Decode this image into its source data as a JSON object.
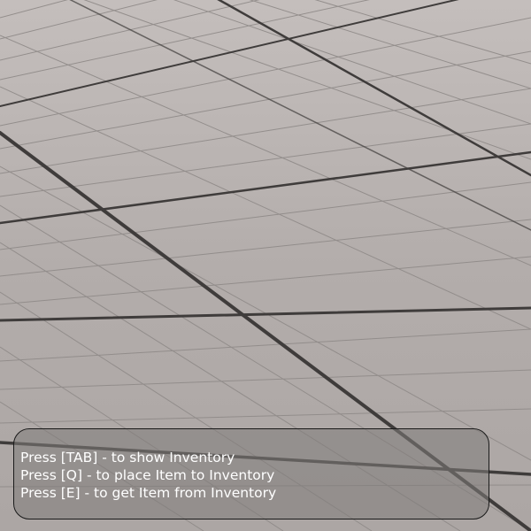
{
  "scene": {
    "floor_base_color": "#b3adab",
    "major_grid_color": "#3f3c3b",
    "minor_grid_color": "#8f8a88"
  },
  "hints": {
    "lines": [
      "Press [TAB] - to show Inventory",
      "Press [Q] - to place Item to Inventory",
      "Press [E] - to get Item from Inventory"
    ],
    "text_color": "#ffffff",
    "panel_color": "#807c7a",
    "border_color": "#1a1a1a"
  }
}
